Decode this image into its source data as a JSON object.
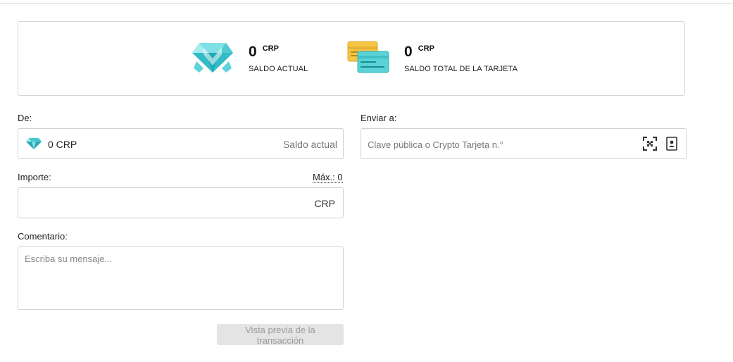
{
  "balances": {
    "current": {
      "amount": "0",
      "unit": "CRP",
      "label": "SALDO ACTUAL",
      "icon": "crystal-logo-icon"
    },
    "card_total": {
      "amount": "0",
      "unit": "CRP",
      "label": "SALDO TOTAL DE LA TARJETA",
      "icon": "crypto-cards-icon"
    }
  },
  "from": {
    "label": "De:",
    "value": "0 CRP",
    "hint": "Saldo actual",
    "icon": "diamond-icon"
  },
  "to": {
    "label": "Enviar a:",
    "placeholder": "Clave pública o Crypto Tarjeta n.°",
    "icons": [
      "qr-scan-icon",
      "address-book-icon"
    ]
  },
  "amount": {
    "label": "Importe:",
    "max_label": "Máx.: 0",
    "unit": "CRP"
  },
  "comment": {
    "label": "Comentario:",
    "placeholder": "Escriba su mensaje..."
  },
  "actions": {
    "preview_label": "Vista previa de la transacción"
  },
  "colors": {
    "crystal": "#3ec7d0",
    "card_yellow": "#f5c643",
    "card_teal": "#5ad3d6",
    "disabled_button": "#e4e4e4"
  }
}
